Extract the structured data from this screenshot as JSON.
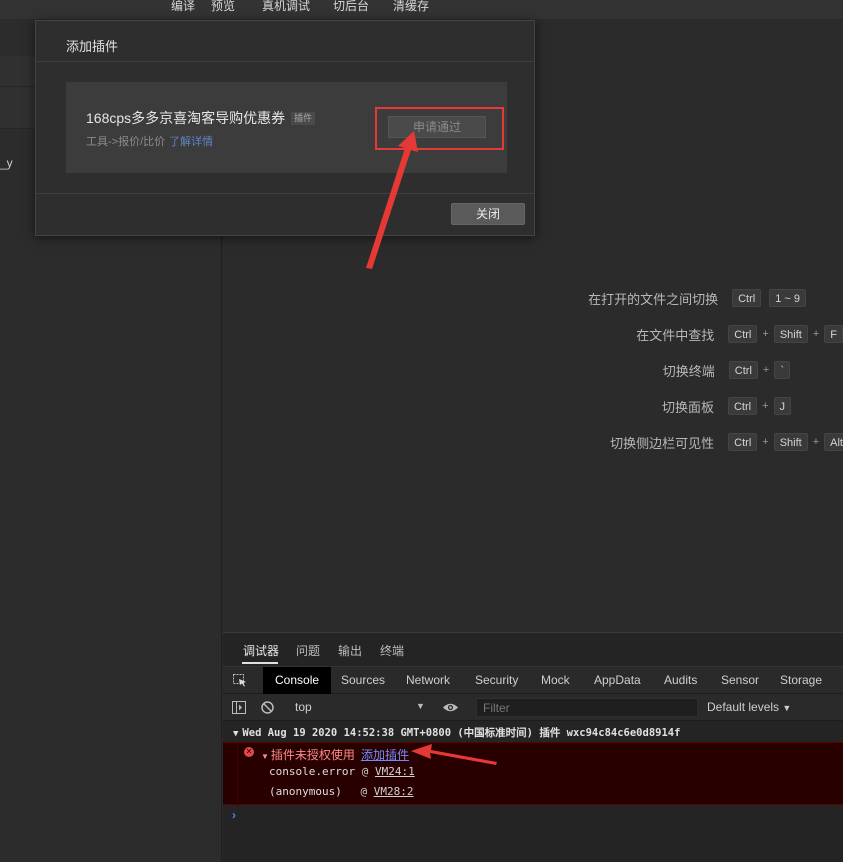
{
  "toolbar": {
    "compile": "编译",
    "preview": "预览",
    "remote_debug": "真机调试",
    "background": "切后台",
    "clear_cache": "清缓存"
  },
  "left_panel": {
    "partial_text": "_y"
  },
  "shortcuts": [
    {
      "label": "在打开的文件之间切换",
      "keys": [
        "Ctrl",
        "1 ~ 9"
      ]
    },
    {
      "label": "在文件中查找",
      "keys": [
        "Ctrl",
        "Shift",
        "F"
      ]
    },
    {
      "label": "切换终端",
      "keys": [
        "Ctrl",
        "`"
      ]
    },
    {
      "label": "切换面板",
      "keys": [
        "Ctrl",
        "J"
      ]
    },
    {
      "label": "切换侧边栏可见性",
      "keys": [
        "Ctrl",
        "Shift",
        "Alt"
      ]
    }
  ],
  "dialog": {
    "title": "添加插件",
    "plugin_name": "168cps多多京喜淘客导购优惠券",
    "plugin_tag": "插件",
    "plugin_desc": "工具->报价/比价",
    "plugin_more": "了解详情",
    "apply_button": "申请通过",
    "close_button": "关闭"
  },
  "devtools": {
    "top_tabs": [
      "调试器",
      "问题",
      "输出",
      "终端"
    ],
    "panel_tabs": [
      "Console",
      "Sources",
      "Network",
      "Security",
      "Mock",
      "AppData",
      "Audits",
      "Sensor",
      "Storage"
    ],
    "context": "top",
    "filter_placeholder": "Filter",
    "levels": "Default levels",
    "group_header": "Wed Aug 19 2020 14:52:38 GMT+0800 (中国标准时间) 插件 wxc94c84c6e0d8914f",
    "error_message": "插件未授权使用",
    "error_link": "添加插件",
    "stack": [
      {
        "fn": "console.error",
        "at": "@",
        "loc": "VM24:1"
      },
      {
        "fn": "(anonymous)",
        "at": "@",
        "loc": "VM28:2"
      }
    ],
    "prompt": "›"
  },
  "colors": {
    "annotation": "#e53935",
    "error_bg": "#290000",
    "link": "#6f8cff"
  }
}
